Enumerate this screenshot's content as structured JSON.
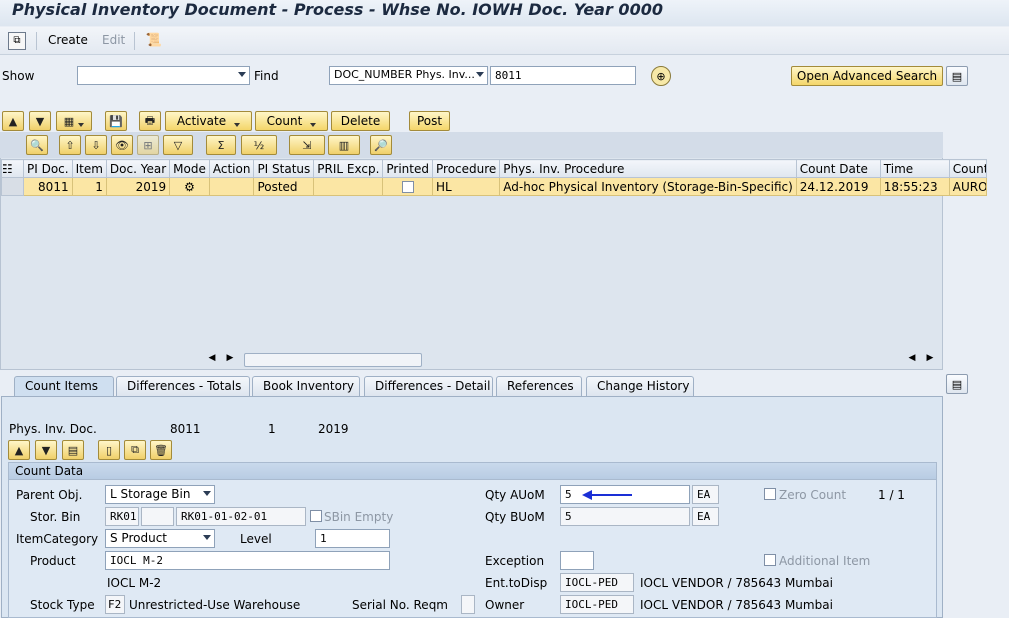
{
  "title": "Physical Inventory Document - Process - Whse No. IOWH Doc. Year 0000",
  "toolbar": {
    "create": "Create",
    "edit": "Edit"
  },
  "search": {
    "show_label": "Show",
    "show_value": "",
    "find_label": "Find",
    "find_field": "DOC_NUMBER Phys. Inv...",
    "find_value": "8011",
    "advanced": "Open Advanced Search"
  },
  "actions": {
    "activate": "Activate",
    "count": "Count",
    "delete": "Delete",
    "post": "Post"
  },
  "grid": {
    "columns": [
      "PI Doc.",
      "Item",
      "Doc. Year",
      "Mode",
      "Action",
      "PI Status",
      "PRIL Excp.",
      "Printed",
      "Procedure",
      "Phys. Inv. Procedure",
      "Count Date",
      "Time",
      "Counte"
    ],
    "row": {
      "pi_doc": "8011",
      "item": "1",
      "doc_year": "2019",
      "mode": "",
      "action": "",
      "pi_status": "Posted",
      "pril": "",
      "printed": "",
      "procedure": "HL",
      "procedure_text": "Ad-hoc Physical Inventory (Storage-Bin-Specific)",
      "count_date": "24.12.2019",
      "time": "18:55:23",
      "counter": "AURO"
    }
  },
  "tabs": [
    "Count Items",
    "Differences - Totals",
    "Book Inventory",
    "Differences - Detail",
    "References",
    "Change History"
  ],
  "detail": {
    "doc_label": "Phys. Inv. Doc.",
    "doc_number": "8011",
    "doc_item": "1",
    "doc_year": "2019",
    "group_title": "Count Data",
    "parent_obj_label": "Parent Obj.",
    "parent_obj_value": "L Storage Bin",
    "stor_bin_label": "Stor. Bin",
    "stor_bin_type": "RK01",
    "stor_bin_sec": "",
    "stor_bin_value": "RK01-01-02-01",
    "sbin_empty": "SBin Empty",
    "item_cat_label": "ItemCategory",
    "item_cat_value": "S Product",
    "level_label": "Level",
    "level_value": "1",
    "product_label": "Product",
    "product_value": "IOCL M-2",
    "product_desc": "IOCL M-2",
    "stock_type_label": "Stock Type",
    "stock_type_code": "F2",
    "stock_type_desc": "Unrestricted-Use Warehouse",
    "serial_label": "Serial No. Reqm",
    "qty_auom_label": "Qty AUoM",
    "qty_auom_value": "5",
    "qty_auom_unit": "EA",
    "qty_buom_label": "Qty BUoM",
    "qty_buom_value": "5",
    "qty_buom_unit": "EA",
    "zero_count": "Zero Count",
    "counter": "1 / 1",
    "exception_label": "Exception",
    "additional_item": "Additional Item",
    "ent_label": "Ent.toDisp",
    "ent_code": "IOCL-PED",
    "ent_desc": "IOCL VENDOR / 785643 Mumbai",
    "owner_label": "Owner",
    "owner_code": "IOCL-PED",
    "owner_desc": "IOCL VENDOR / 785643 Mumbai"
  },
  "colors": {
    "accent_arrow": "#1a2fd6",
    "selected_row": "#fbe6a4",
    "button": "#f4d66a"
  }
}
